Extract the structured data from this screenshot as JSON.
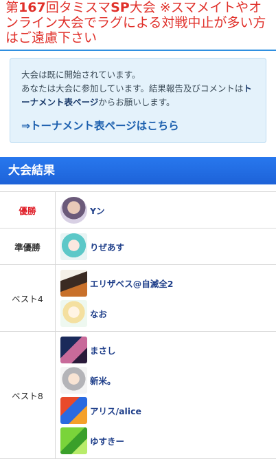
{
  "title": {
    "prefix": "第",
    "number": "167",
    "middle": "回タミスマ",
    "sp": "SP",
    "rest": "大会 ※スマメイトやオンライン大会でラグによる対戦中止が多い方はご遠慮下さい"
  },
  "notice": {
    "line1": "大会は既に開始されています。",
    "line2a": "あなたは大会に参加しています。結果報告及びコメントは",
    "line2b": "トーナメント表ページ",
    "line2c": "からお願いします。",
    "link": "⇒トーナメント表ページはこちら"
  },
  "section_title": "大会結果",
  "results": [
    {
      "rank": "優勝",
      "players": [
        {
          "name": "Yン",
          "icon": "avatar-icon"
        }
      ]
    },
    {
      "rank": "準優勝",
      "players": [
        {
          "name": "りぜあす",
          "icon": "avatar-icon"
        }
      ]
    },
    {
      "rank": "ベスト4",
      "players": [
        {
          "name": "エリザベス@自滅全2",
          "icon": "avatar-icon"
        },
        {
          "name": "なお",
          "icon": "avatar-icon"
        }
      ]
    },
    {
      "rank": "ベスト8",
      "players": [
        {
          "name": "まさし",
          "icon": "avatar-icon"
        },
        {
          "name": "新米。",
          "icon": "avatar-icon"
        },
        {
          "name": "アリス/alice",
          "icon": "avatar-icon"
        },
        {
          "name": "ゆすきー",
          "icon": "avatar-icon"
        }
      ]
    }
  ],
  "colors": {
    "title": "#e0302a",
    "accent": "#1d62d8",
    "winner": "#e0202a",
    "player_name": "#1f3f8a"
  }
}
